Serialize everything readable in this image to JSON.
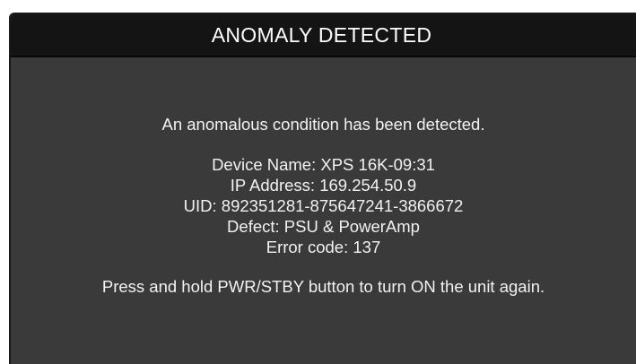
{
  "dialog": {
    "title": "ANOMALY DETECTED",
    "message": "An anomalous condition has been detected.",
    "details": {
      "device_name": "Device Name: XPS 16K-09:31",
      "ip_address": "IP Address: 169.254.50.9",
      "uid": "UID: 892351281-875647241-3866672",
      "defect": "Defect: PSU & PowerAmp",
      "error_code": "Error code: 137"
    },
    "instruction": "Press and hold PWR/STBY button to turn ON the unit again."
  },
  "colors": {
    "title_bar_bg": "#141414",
    "panel_bg": "#3a3a3a",
    "text": "#f2f2f2"
  }
}
